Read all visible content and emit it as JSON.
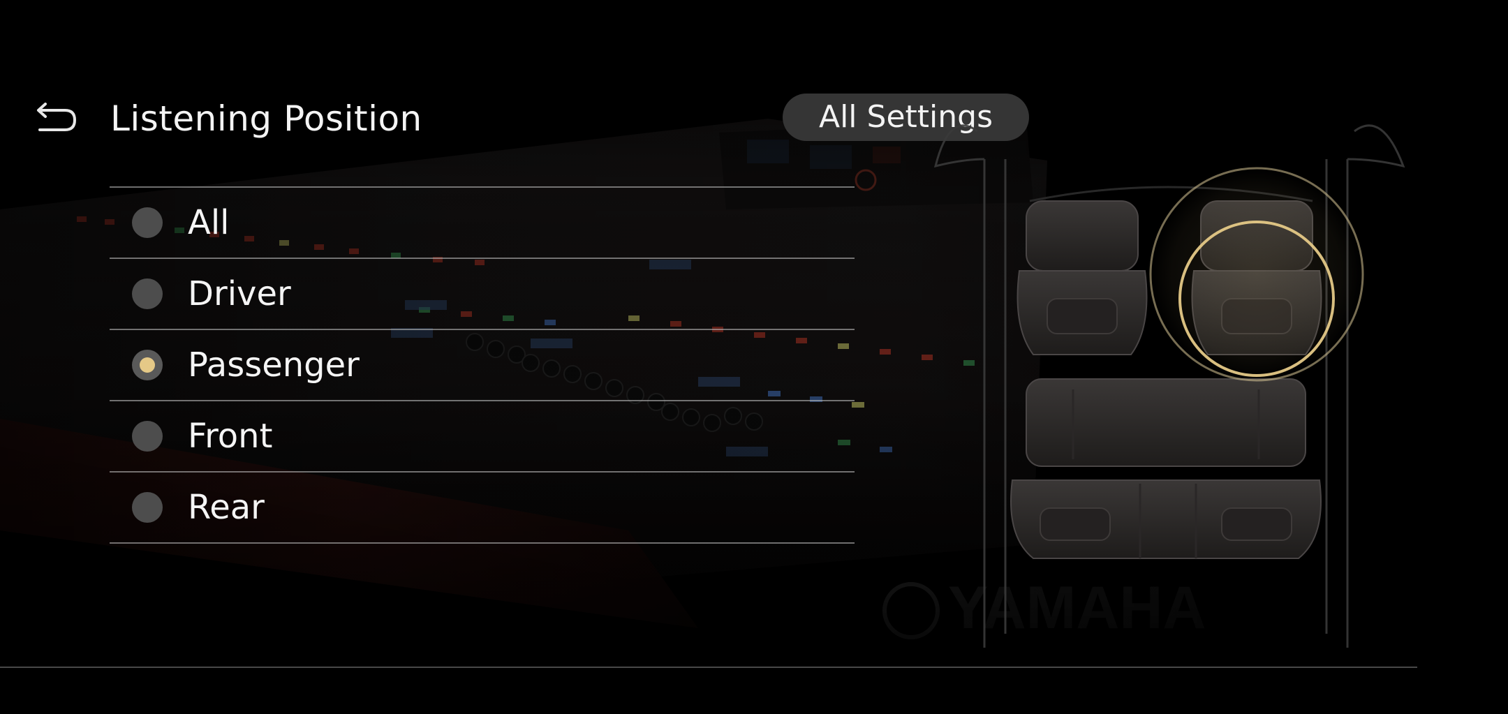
{
  "header": {
    "title": "Listening Position",
    "all_settings_label": "All Settings"
  },
  "listening_position": {
    "options": [
      {
        "label": "All",
        "selected": false
      },
      {
        "label": "Driver",
        "selected": false
      },
      {
        "label": "Passenger",
        "selected": true
      },
      {
        "label": "Front",
        "selected": false
      },
      {
        "label": "Rear",
        "selected": false
      }
    ],
    "selected_option": "Passenger"
  },
  "background": {
    "brand_logo": "YAMAHA"
  },
  "colors": {
    "accent": "#e5c987",
    "radio_off": "#4d4d4d",
    "button_bg": "#3a3a3a",
    "background": "#000000"
  },
  "icons": {
    "back": "back-arrow-icon",
    "brand": "yamaha-logo-icon"
  }
}
